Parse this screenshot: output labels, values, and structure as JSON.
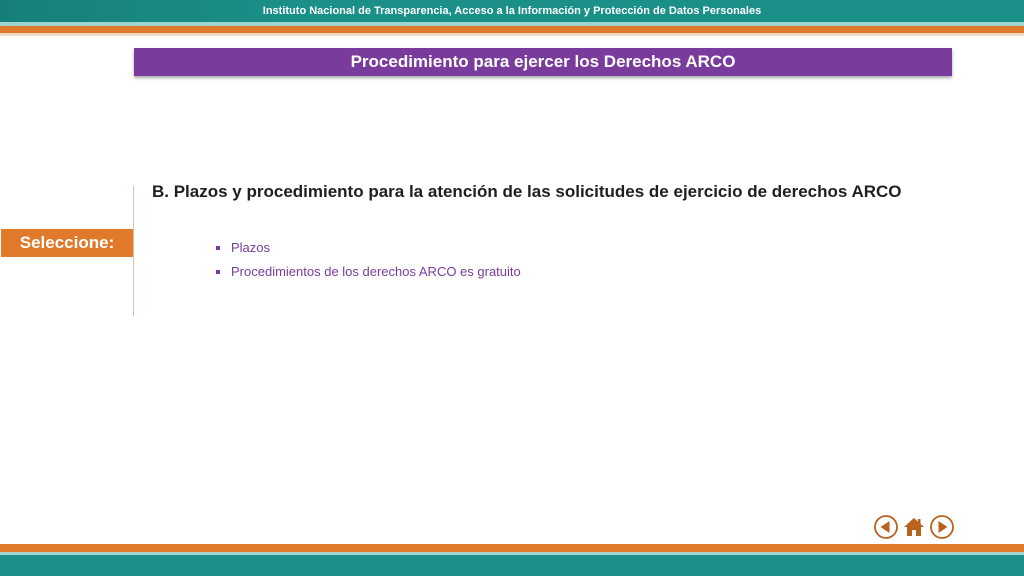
{
  "header": {
    "institution": "Instituto Nacional de Transparencia, Acceso a la Información y Protección de Datos Personales"
  },
  "banner": {
    "title": "Procedimiento para ejercer los Derechos ARCO"
  },
  "section": {
    "heading": "B. Plazos y procedimiento para la atención de las solicitudes de ejercicio de derechos ARCO"
  },
  "selector": {
    "label": "Seleccione:"
  },
  "options": [
    {
      "label": "Plazos"
    },
    {
      "label": "Procedimientos de los derechos ARCO es gratuito"
    }
  ],
  "nav": {
    "icons": [
      "back-arrow-icon",
      "home-icon",
      "forward-arrow-icon"
    ]
  },
  "colors": {
    "teal": "#1a9088",
    "orange": "#e07a2a",
    "purple": "#7a3c9c"
  }
}
